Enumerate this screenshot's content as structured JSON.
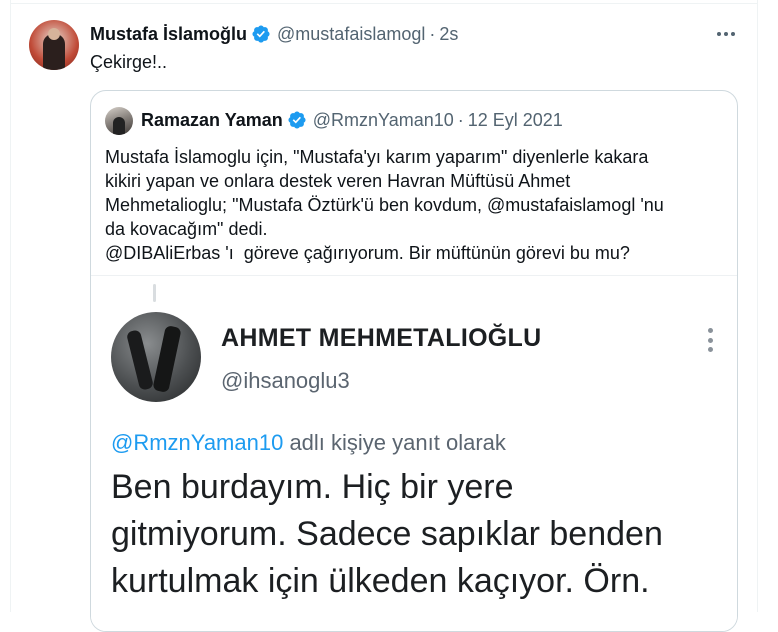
{
  "tweet": {
    "author_name": "Mustafa İslamoğlu",
    "author_handle": "@mustafaislamogl",
    "separator": "·",
    "time": "2s",
    "text": "Çekirge!..",
    "more_icon": "more-horizontal-icon"
  },
  "quoted": {
    "author_name": "Ramazan Yaman",
    "author_handle": "@RmznYaman10",
    "separator": "·",
    "date": "12 Eyl 2021",
    "text": "Mustafa İslamoglu için, \"Mustafa'yı karım yaparım\" diyenlerle kakara\nkikiri yapan ve onlara destek veren Havran Müftüsü Ahmet\nMehmetalioglu; \"Mustafa Öztürk'ü ben kovdum, @mustafaislamogl 'nu\nda kovacağım\" dedi.\n@DIBAliErbas 'ı  göreve çağırıyorum. Bir müftünün görevi bu mu?"
  },
  "media": {
    "name": "AHMET MEHMETALIOĞLU",
    "handle": "@ihsanoglu3",
    "reply_handle": "@RmznYaman10",
    "reply_suffix": " adlı kişiye yanıt olarak",
    "body": "Ben burdayım. Hiç bir yere\ngitmiyorum. Sadece sapıklar benden\nkurtulmak için ülkeden kaçıyor. Örn."
  },
  "colors": {
    "accent": "#1d9bf0",
    "text": "#0f1419",
    "muted": "#536471",
    "border": "#cfd9de"
  }
}
